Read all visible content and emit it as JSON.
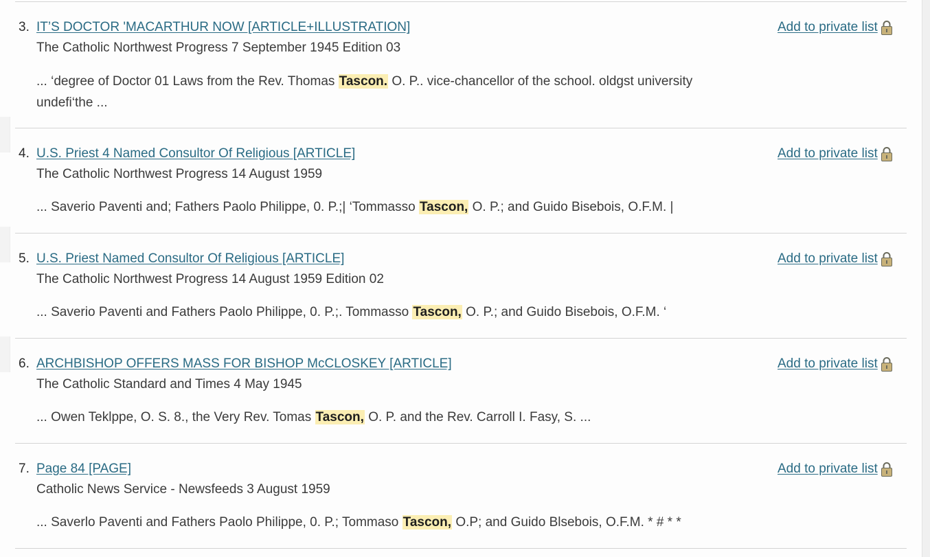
{
  "add_label": "Add to private list",
  "results": [
    {
      "number": "3.",
      "title": "IT’S DOCTOR 'MACARTHUR NOW [ARTICLE+ILLUSTRATION]",
      "source": "The Catholic Northwest Progress 7 September 1945 Edition 03",
      "snippet_before": "... ‘degree of Doctor 01 Laws from the Rev. Thomas ",
      "highlight": "Tascon.",
      "snippet_after": " O. P.. vice-chancellor of the school. oldgst university undefi‘the ..."
    },
    {
      "number": "4.",
      "title": "U.S. Priest 4 Named Consultor Of Religious [ARTICLE]",
      "source": "The Catholic Northwest Progress 14 August 1959",
      "snippet_before": "... Saverio Paventi and; Fathers Paolo Philippe, 0. P.;| ‘Tommasso ",
      "highlight": "Tascon,",
      "snippet_after": " O. P.; and Guido Bisebois, O.F.M. |"
    },
    {
      "number": "5.",
      "title": "U.S. Priest Named Consultor Of Religious [ARTICLE]",
      "source": "The Catholic Northwest Progress 14 August 1959 Edition 02",
      "snippet_before": "... Saverio Paventi and Fathers Paolo Philippe, 0. P.;. Tommasso ",
      "highlight": "Tascon,",
      "snippet_after": " O. P.; and Guido Bisebois, O.F.M. ‘"
    },
    {
      "number": "6.",
      "title": "ARCHBISHOP OFFERS MASS FOR BISHOP McCLOSKEY [ARTICLE]",
      "source": "The Catholic Standard and Times 4 May 1945",
      "snippet_before": "... Owen Teklppe, O. S. 8., the Very Rev. Tomas ",
      "highlight": "Tascon,",
      "snippet_after": " O. P. and the Rev. Carroll I. Fasy, S. ..."
    },
    {
      "number": "7.",
      "title": "Page 84 [PAGE]",
      "source": "Catholic News Service - Newsfeeds 3 August 1959",
      "snippet_before": "... Saverlo Paventi and Fathers Paolo Philippe, 0. P.; Tommaso ",
      "highlight": "Tascon,",
      "snippet_after": " O.P; and Guido Blsebois, O.F.M. * # * *"
    }
  ],
  "colors": {
    "link": "#2a6b84",
    "text": "#3b3b3b",
    "highlight_bg": "#fbeeb3",
    "divider": "#d4d4d4"
  }
}
